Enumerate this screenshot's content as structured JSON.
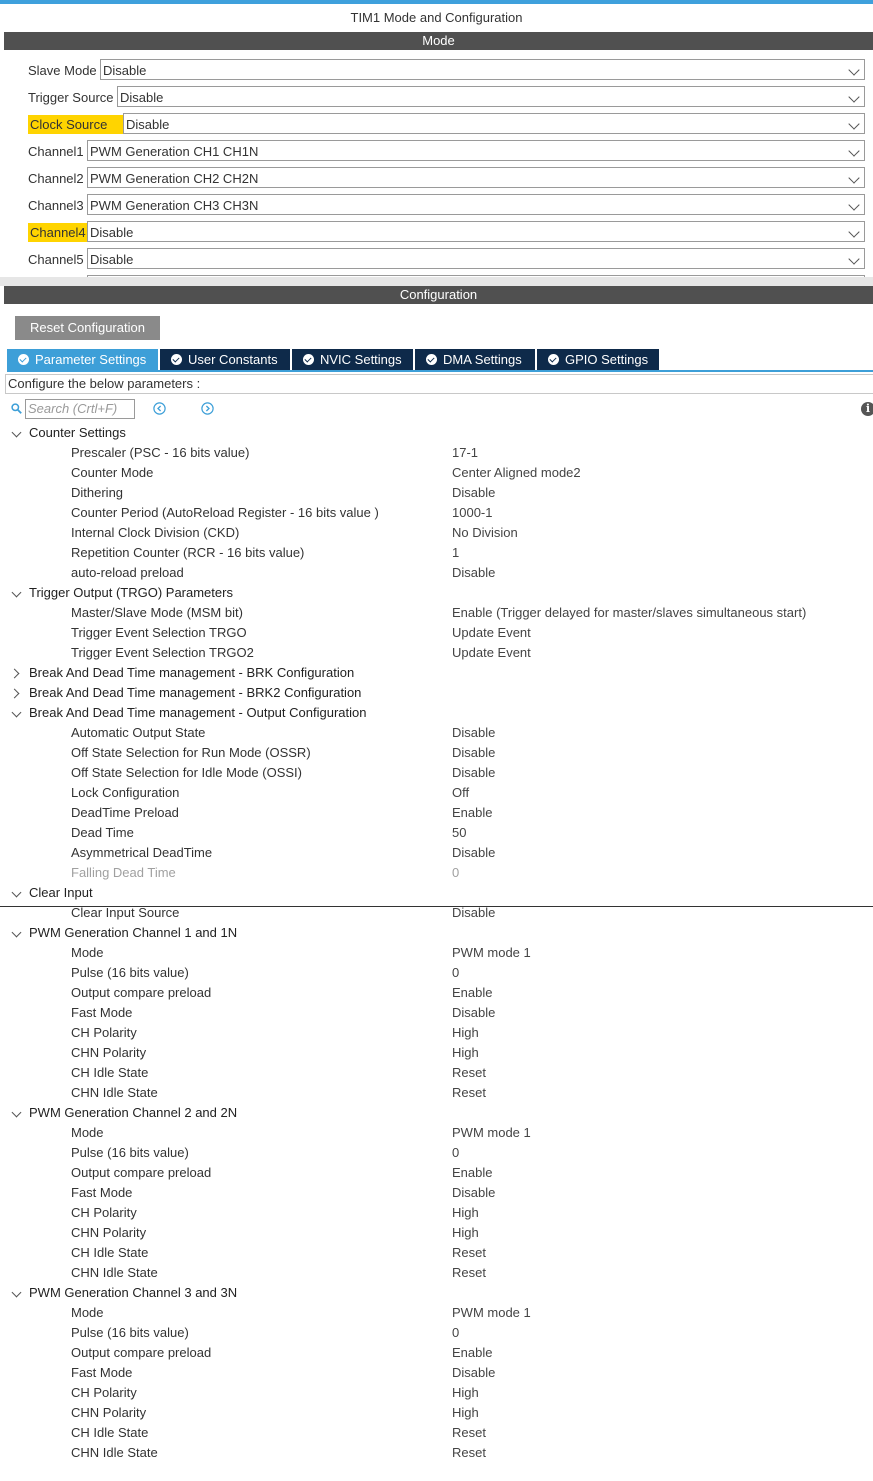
{
  "window": {
    "title": "TIM1 Mode and Configuration"
  },
  "mode_section": {
    "header": "Mode",
    "rows": [
      {
        "label": "Slave Mode",
        "value": "Disable",
        "highlight": false
      },
      {
        "label": "Trigger Source",
        "value": "Disable",
        "highlight": false
      },
      {
        "label": "Clock Source",
        "value": "Disable",
        "highlight": true
      },
      {
        "label": "Channel1",
        "value": "PWM Generation CH1 CH1N",
        "highlight": false
      },
      {
        "label": "Channel2",
        "value": "PWM Generation CH2 CH2N",
        "highlight": false
      },
      {
        "label": "Channel3",
        "value": "PWM Generation CH3 CH3N",
        "highlight": false
      },
      {
        "label": "Channel4",
        "value": "Disable",
        "highlight": true
      },
      {
        "label": "Channel5",
        "value": "Disable",
        "highlight": false
      }
    ],
    "highlight_color": "#ffd400"
  },
  "config_section": {
    "header": "Configuration",
    "reset_button": "Reset Configuration",
    "tabs": [
      {
        "label": "Parameter Settings",
        "active": true
      },
      {
        "label": "User Constants",
        "active": false
      },
      {
        "label": "NVIC Settings",
        "active": false
      },
      {
        "label": "DMA Settings",
        "active": false
      },
      {
        "label": "GPIO Settings",
        "active": false
      }
    ],
    "instruction": "Configure the below parameters :",
    "search_placeholder": "Search (Crtl+F)",
    "icons": [
      "search-icon",
      "prev-icon",
      "next-icon",
      "info-icon",
      "check-icon",
      "expand-icon",
      "collapse-icon",
      "dropdown-chevron-icon"
    ]
  },
  "tree": [
    {
      "type": "group",
      "name": "Counter Settings",
      "expanded": true
    },
    {
      "type": "param",
      "name": "Prescaler (PSC - 16 bits value)",
      "value": "17-1"
    },
    {
      "type": "param",
      "name": "Counter Mode",
      "value": "Center Aligned mode2"
    },
    {
      "type": "param",
      "name": "Dithering",
      "value": "Disable"
    },
    {
      "type": "param",
      "name": "Counter Period (AutoReload Register - 16 bits value )",
      "value": "1000-1"
    },
    {
      "type": "param",
      "name": "Internal Clock Division (CKD)",
      "value": "No Division"
    },
    {
      "type": "param",
      "name": "Repetition Counter (RCR - 16 bits value)",
      "value": "1"
    },
    {
      "type": "param",
      "name": "auto-reload preload",
      "value": "Disable"
    },
    {
      "type": "group",
      "name": "Trigger Output (TRGO) Parameters",
      "expanded": true
    },
    {
      "type": "param",
      "name": "Master/Slave Mode (MSM bit)",
      "value": "Enable (Trigger delayed for master/slaves simultaneous start)"
    },
    {
      "type": "param",
      "name": "Trigger Event Selection TRGO",
      "value": "Update Event"
    },
    {
      "type": "param",
      "name": "Trigger Event Selection TRGO2",
      "value": "Update Event"
    },
    {
      "type": "group",
      "name": "Break And Dead Time management - BRK Configuration",
      "expanded": false
    },
    {
      "type": "group",
      "name": "Break And Dead Time management - BRK2 Configuration",
      "expanded": false
    },
    {
      "type": "group",
      "name": "Break And Dead Time management - Output Configuration",
      "expanded": true
    },
    {
      "type": "param",
      "name": "Automatic Output State",
      "value": "Disable"
    },
    {
      "type": "param",
      "name": "Off State Selection for Run Mode (OSSR)",
      "value": "Disable"
    },
    {
      "type": "param",
      "name": "Off State Selection for Idle Mode (OSSI)",
      "value": "Disable"
    },
    {
      "type": "param",
      "name": "Lock Configuration",
      "value": "Off"
    },
    {
      "type": "param",
      "name": "DeadTime Preload",
      "value": "Enable"
    },
    {
      "type": "param",
      "name": "Dead Time",
      "value": "50"
    },
    {
      "type": "param",
      "name": "Asymmetrical DeadTime",
      "value": "Disable"
    },
    {
      "type": "param",
      "name": "Falling Dead Time",
      "value": "0",
      "disabled": true
    },
    {
      "type": "group",
      "name": "Clear Input",
      "expanded": true
    },
    {
      "type": "param",
      "name": "Clear Input Source",
      "value": "Disable"
    },
    {
      "type": "group",
      "name": "PWM Generation Channel 1 and 1N",
      "expanded": true
    },
    {
      "type": "param",
      "name": "Mode",
      "value": "PWM mode 1"
    },
    {
      "type": "param",
      "name": "Pulse (16 bits value)",
      "value": "0"
    },
    {
      "type": "param",
      "name": "Output compare preload",
      "value": "Enable"
    },
    {
      "type": "param",
      "name": "Fast Mode",
      "value": "Disable"
    },
    {
      "type": "param",
      "name": "CH Polarity",
      "value": "High"
    },
    {
      "type": "param",
      "name": "CHN Polarity",
      "value": "High"
    },
    {
      "type": "param",
      "name": "CH Idle State",
      "value": "Reset"
    },
    {
      "type": "param",
      "name": "CHN Idle State",
      "value": "Reset"
    },
    {
      "type": "group",
      "name": "PWM Generation Channel 2 and 2N",
      "expanded": true
    },
    {
      "type": "param",
      "name": "Mode",
      "value": "PWM mode 1"
    },
    {
      "type": "param",
      "name": "Pulse (16 bits value)",
      "value": "0"
    },
    {
      "type": "param",
      "name": "Output compare preload",
      "value": "Enable"
    },
    {
      "type": "param",
      "name": "Fast Mode",
      "value": "Disable"
    },
    {
      "type": "param",
      "name": "CH Polarity",
      "value": "High"
    },
    {
      "type": "param",
      "name": "CHN Polarity",
      "value": "High"
    },
    {
      "type": "param",
      "name": "CH Idle State",
      "value": "Reset"
    },
    {
      "type": "param",
      "name": "CHN Idle State",
      "value": "Reset"
    },
    {
      "type": "group",
      "name": "PWM Generation Channel 3 and 3N",
      "expanded": true
    },
    {
      "type": "param",
      "name": "Mode",
      "value": "PWM mode 1"
    },
    {
      "type": "param",
      "name": "Pulse (16 bits value)",
      "value": "0"
    },
    {
      "type": "param",
      "name": "Output compare preload",
      "value": "Enable"
    },
    {
      "type": "param",
      "name": "Fast Mode",
      "value": "Disable"
    },
    {
      "type": "param",
      "name": "CH Polarity",
      "value": "High"
    },
    {
      "type": "param",
      "name": "CHN Polarity",
      "value": "High"
    },
    {
      "type": "param",
      "name": "CH Idle State",
      "value": "Reset"
    },
    {
      "type": "param",
      "name": "CHN Idle State",
      "value": "Reset"
    }
  ]
}
